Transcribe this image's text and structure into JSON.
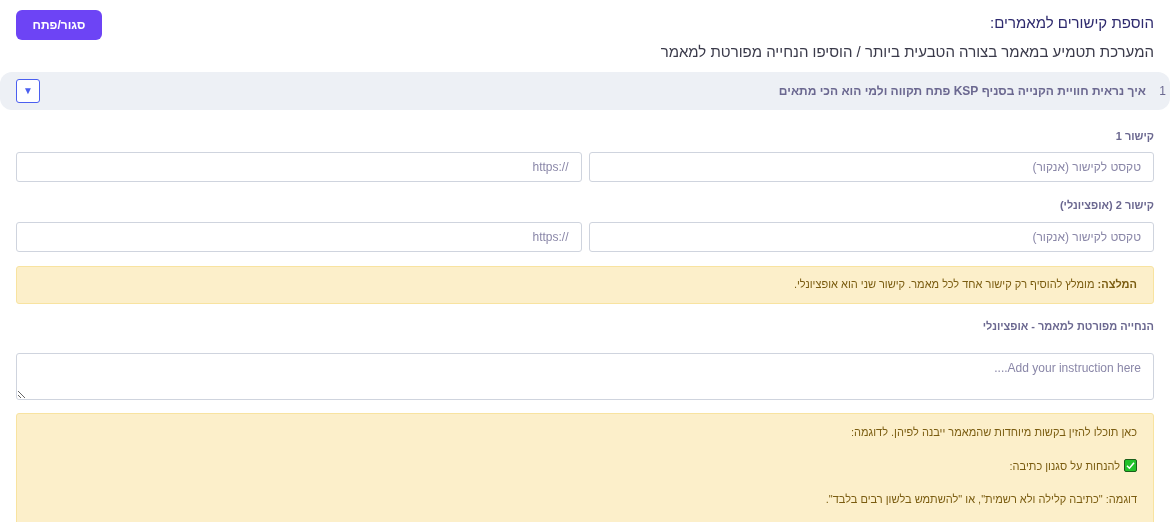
{
  "toggle_button": "סגור/פתח",
  "title": "הוספת קישורים למאמרים:",
  "subtitle": "המערכת תטמיע במאמר בצורה הטבעית ביותר / הוסיפו הנחייה מפורטת למאמר",
  "article": {
    "number": "1",
    "question": "איך נראית חוויית הקנייה בסניף KSP פתח תקווה ולמי הוא הכי מתאים",
    "expand_button": "▼",
    "expanded": true
  },
  "links": [
    {
      "label": "קישור 1",
      "anchor_placeholder": "טקסט לקישור (אנקור)",
      "url_placeholder": "https://"
    },
    {
      "label": "קישור 2 (אופציונלי)",
      "anchor_placeholder": "טקסט לקישור (אנקור)",
      "url_placeholder": "https://"
    }
  ],
  "recommendation": "**המלצה:** מומלץ להוסיף רק קישור אחד לכל מאמר. קישור שני הוא אופציונלי.",
  "instruction": {
    "label": "הנחייה מפורטת למאמר - אופציונלי",
    "placeholder": "Add your instruction here...."
  },
  "help": {
    "intro": "כאן תוכלו להזין בקשות מיוחדות שהמאמר ייבנה לפיהן. לדוגמה:",
    "items": [
      {
        "title": "להנחות על סגנון כתיבה:",
        "example": "דוגמה: \"כתיבה קלילה ולא רשמית\", או \"להשתמש בלשון רבים בלבד\"."
      }
    ]
  }
}
